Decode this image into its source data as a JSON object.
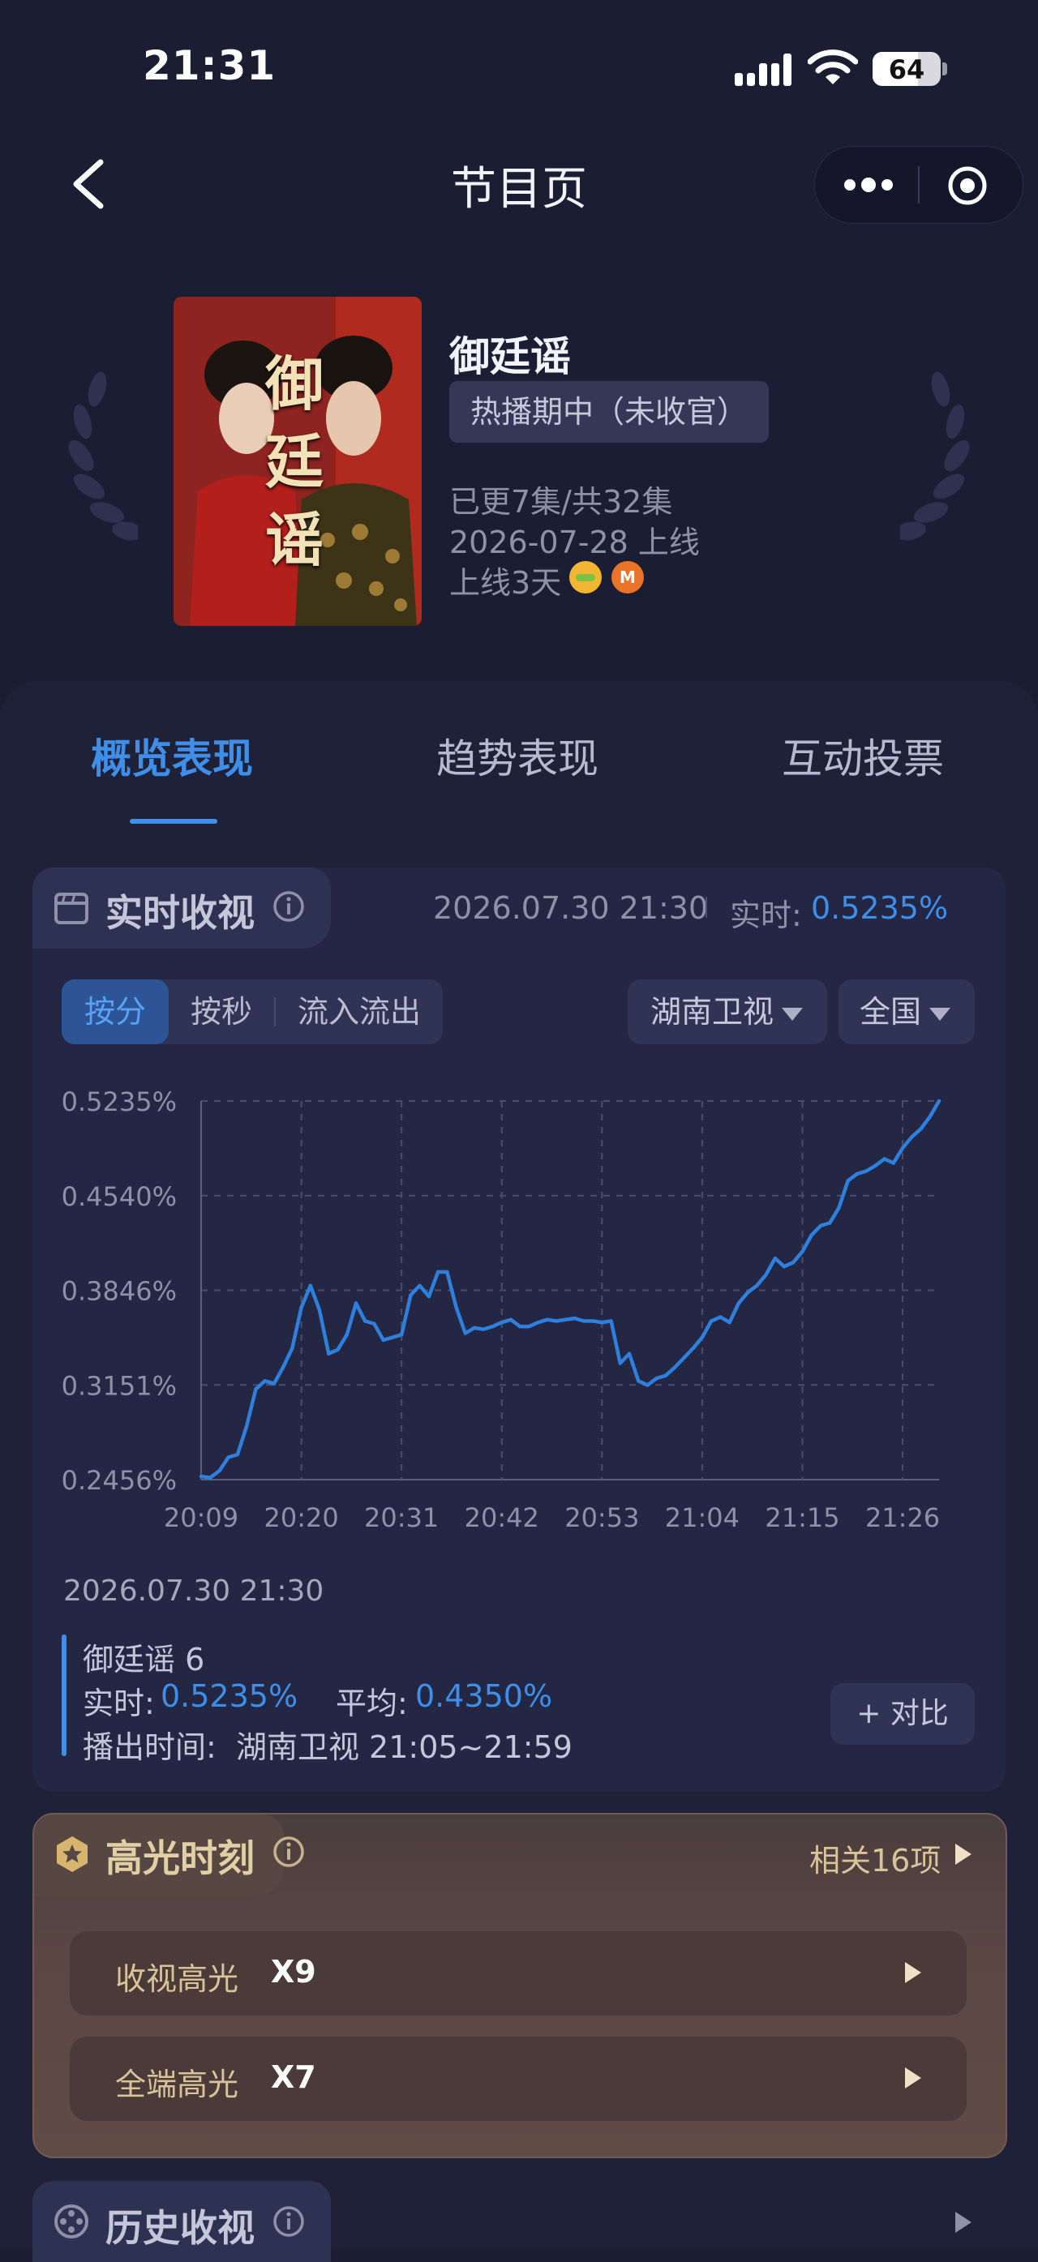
{
  "status_bar": {
    "time": "21:31",
    "battery": "64"
  },
  "nav": {
    "title": "节目页"
  },
  "show": {
    "title": "御廷谣",
    "status_chip": "热播期中（未收官）",
    "episodes": "已更7集/共32集",
    "release": "2026-07-28 上线",
    "days_online": "上线3天",
    "poster_text": "御廷谣"
  },
  "tabs": [
    "概览表现",
    "趋势表现",
    "互动投票"
  ],
  "realtime": {
    "section_title": "实时收视",
    "timestamp": "2026.07.30 21:30",
    "realtime_label": "实时:",
    "realtime_value": "0.5235%"
  },
  "controls": {
    "segments": [
      "按分",
      "按秒",
      "流入流出"
    ],
    "channel": "湖南卫视",
    "region": "全国"
  },
  "chart_data": {
    "type": "line",
    "title": "",
    "xlabel": "",
    "ylabel": "",
    "x_ticks": [
      "20:09",
      "20:20",
      "20:31",
      "20:42",
      "20:53",
      "21:04",
      "21:15",
      "21:26"
    ],
    "y_ticks": [
      "0.5235%",
      "0.4540%",
      "0.3846%",
      "0.3151%",
      "0.2456%"
    ],
    "ylim": [
      0.2456,
      0.5235
    ],
    "grid": true,
    "color": "#2f7fdc",
    "x": [
      "20:09",
      "20:10",
      "20:11",
      "20:12",
      "20:13",
      "20:14",
      "20:15",
      "20:16",
      "20:17",
      "20:18",
      "20:19",
      "20:20",
      "20:21",
      "20:22",
      "20:23",
      "20:24",
      "20:25",
      "20:26",
      "20:27",
      "20:28",
      "20:29",
      "20:30",
      "20:31",
      "20:32",
      "20:33",
      "20:34",
      "20:35",
      "20:36",
      "20:37",
      "20:38",
      "20:39",
      "20:40",
      "20:41",
      "20:42",
      "20:43",
      "20:44",
      "20:45",
      "20:46",
      "20:47",
      "20:48",
      "20:49",
      "20:50",
      "20:51",
      "20:52",
      "20:53",
      "20:54",
      "20:55",
      "20:56",
      "20:57",
      "20:58",
      "20:59",
      "21:00",
      "21:01",
      "21:02",
      "21:03",
      "21:04",
      "21:05",
      "21:06",
      "21:07",
      "21:08",
      "21:09",
      "21:10",
      "21:11",
      "21:12",
      "21:13",
      "21:14",
      "21:15",
      "21:16",
      "21:17",
      "21:18",
      "21:19",
      "21:20",
      "21:21",
      "21:22",
      "21:23",
      "21:24",
      "21:25",
      "21:26",
      "21:27",
      "21:28",
      "21:29",
      "21:30"
    ],
    "values": [
      0.248,
      0.247,
      0.252,
      0.262,
      0.264,
      0.285,
      0.312,
      0.318,
      0.316,
      0.328,
      0.342,
      0.372,
      0.388,
      0.37,
      0.338,
      0.341,
      0.352,
      0.375,
      0.362,
      0.36,
      0.348,
      0.35,
      0.352,
      0.381,
      0.388,
      0.38,
      0.398,
      0.398,
      0.372,
      0.353,
      0.357,
      0.356,
      0.358,
      0.361,
      0.363,
      0.358,
      0.358,
      0.361,
      0.363,
      0.362,
      0.363,
      0.364,
      0.362,
      0.362,
      0.361,
      0.362,
      0.331,
      0.338,
      0.318,
      0.315,
      0.32,
      0.322,
      0.328,
      0.335,
      0.342,
      0.35,
      0.362,
      0.365,
      0.361,
      0.375,
      0.383,
      0.388,
      0.396,
      0.408,
      0.402,
      0.405,
      0.413,
      0.425,
      0.432,
      0.434,
      0.445,
      0.465,
      0.47,
      0.472,
      0.476,
      0.481,
      0.478,
      0.489,
      0.497,
      0.503,
      0.512,
      0.5235
    ]
  },
  "detail": {
    "timestamp": "2026.07.30 21:30",
    "episode": "御廷谣 6",
    "realtime_label": "实时:",
    "realtime_value": "0.5235%",
    "average_label": "平均:",
    "average_value": "0.4350%",
    "airtime": "播出时间:  湖南卫视 21:05~21:59",
    "compare_button": "+ 对比"
  },
  "highlights": {
    "title": "高光时刻",
    "related": "相关16项",
    "rows": [
      {
        "label": "收视高光",
        "value": "X9"
      },
      {
        "label": "全端高光",
        "value": "X7"
      }
    ]
  },
  "history": {
    "title": "历史收视"
  },
  "colors": {
    "accent": "#3f8ee8",
    "background": "#1b1d33",
    "highlight_gold": "#e1cfa5"
  },
  "icons": [
    "back-icon",
    "more-icon",
    "target-icon",
    "info-icon",
    "calendar-icon",
    "star-badge-icon",
    "play-arrow-icon"
  ]
}
